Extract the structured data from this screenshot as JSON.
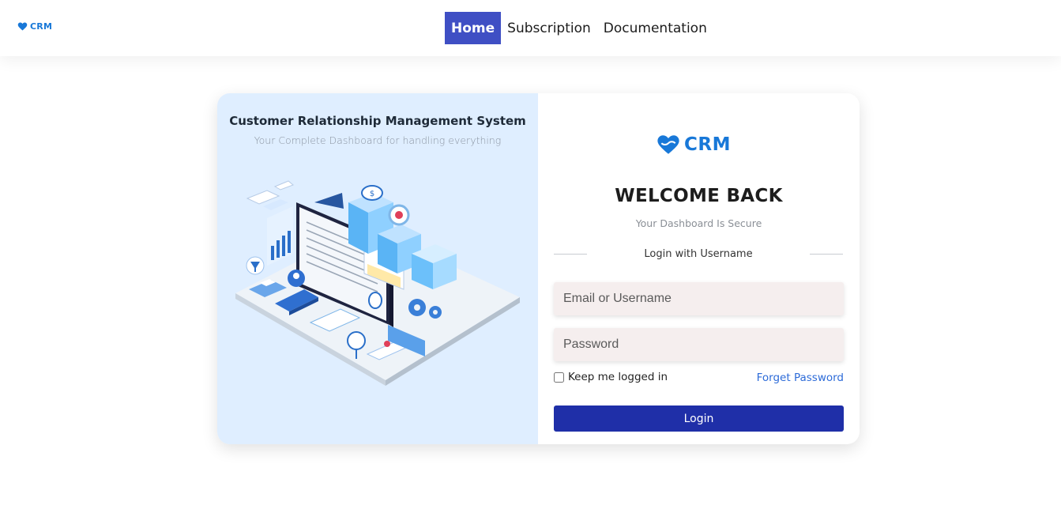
{
  "header": {
    "brand": "CRM",
    "nav": [
      {
        "label": "Home",
        "active": true
      },
      {
        "label": "Subscription",
        "active": false
      },
      {
        "label": "Documentation",
        "active": false
      }
    ]
  },
  "hero": {
    "title": "Customer Relationship Management System",
    "subtitle": "Your Complete Dashboard for handling everything",
    "illustration_icon": "isometric-dashboard-illustration"
  },
  "login": {
    "logo_text": "CRM",
    "welcome": "WELCOME BACK",
    "secure_text": "Your Dashboard Is Secure",
    "divider_text": "Login with Username",
    "username_placeholder": "Email or Username",
    "password_placeholder": "Password",
    "remember_label": "Keep me logged in",
    "remember_checked": false,
    "forget_label": "Forget Password",
    "submit_label": "Login"
  },
  "colors": {
    "brand": "#1878d8",
    "nav_active": "#3f4fc4",
    "login_button": "#1f2fa8",
    "left_panel": "#dfeeff",
    "link": "#2d6bd8"
  }
}
